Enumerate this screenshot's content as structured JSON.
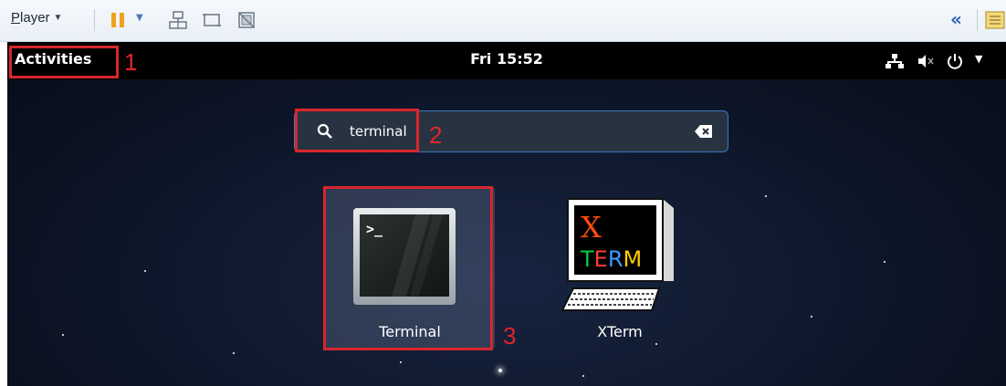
{
  "toolbar": {
    "player_label_first": "P",
    "player_label_rest": "layer",
    "collapse_glyph": "«"
  },
  "top_bar": {
    "activities_label": "Activities",
    "clock": "Fri 15:52"
  },
  "search": {
    "query": "terminal"
  },
  "results": [
    {
      "label": "Terminal",
      "icon": "terminal-icon",
      "selected": true
    },
    {
      "label": "XTerm",
      "icon": "xterm-icon",
      "selected": false
    }
  ],
  "xterm_icon_text": {
    "top": "X",
    "bottom": "TERM"
  },
  "annotations": {
    "one": "1",
    "two": "2",
    "three": "3",
    "color": "#d7262c"
  },
  "colors": {
    "topbar": "#000000",
    "search_border": "#3b78c4",
    "desktop": "#0d1629",
    "pause": "#f0a020"
  }
}
